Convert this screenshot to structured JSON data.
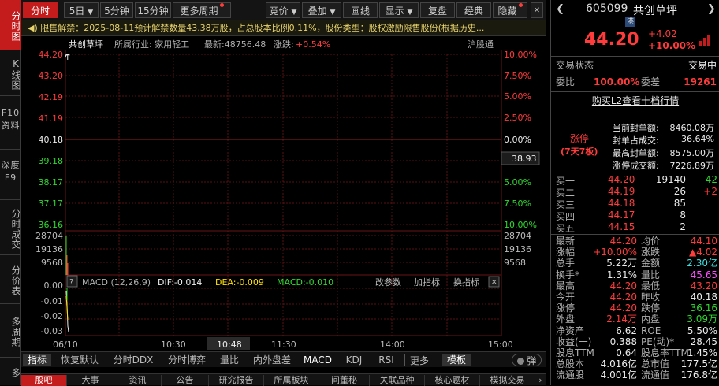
{
  "left_tabs": [
    "分时图",
    "K线图",
    "F10资料",
    "深度F9",
    "分时成交",
    "分价表",
    "多周期",
    "多"
  ],
  "toolbar": {
    "period_tabs": [
      "分时",
      "5日",
      "5分钟",
      "15分钟",
      "更多周期"
    ],
    "tools": [
      "竞价",
      "叠加",
      "画线",
      "显示",
      "复盘",
      "经典",
      "隐藏"
    ]
  },
  "notice": "限售解禁：2025-08-11预计解禁数量43.38万股，占总股本比例0.11%，股份类型：股权激励限售股份(根据历史...",
  "chart_header": {
    "name": "共创草坪",
    "industry": "所属行业: 家用轻工",
    "latest": "最新:48756.48",
    "change_label": "涨跌:",
    "change_value": "+0.54%",
    "exchange": "沪股通"
  },
  "chart_data": {
    "type": "line",
    "x": [
      "06/10",
      "10:30",
      "10:48",
      "11:30",
      "14:00",
      "15:00"
    ],
    "y_left": [
      "44.20",
      "43.20",
      "42.19",
      "41.19",
      "40.18",
      "39.18",
      "38.17",
      "37.17",
      "36.16"
    ],
    "y_right": [
      "10.00%",
      "7.50%",
      "5.00%",
      "2.50%",
      "0.00%",
      "5.00%",
      "7.50%",
      "10.00%"
    ],
    "cursor_price": "38.93",
    "volume_ticks": [
      "28704",
      "19136",
      "9568"
    ],
    "macd_ticks": [
      "0.00",
      "-0.01",
      "-0.02",
      "-0.03"
    ],
    "macd_label": "MACD (12,26,9)",
    "dif": "DIF:-0.014",
    "dea": "DEA:-0.009",
    "macd": "MACD:-0.010",
    "macd_actions": [
      "改参数",
      "加指标",
      "换指标"
    ]
  },
  "bottom_tabs": [
    "指标",
    "恢复默认",
    "分时DDX",
    "分时博弈",
    "量比",
    "内外盘差",
    "MACD",
    "KDJ",
    "RSI",
    "更多",
    "模板",
    "弹"
  ],
  "footer_tabs": [
    "股吧",
    "大事",
    "资讯",
    "公告",
    "研究报告",
    "所属板块",
    "问董秘",
    "关联品种",
    "核心题材",
    "模拟交易"
  ],
  "right": {
    "code": "605099",
    "name": "共创草坪",
    "market": "港",
    "price": "44.20",
    "change": "+4.02",
    "change_pct": "+10.00%",
    "trade_status_label": "交易状态",
    "trade_status": "交易中",
    "wb_label": "委比",
    "wb": "100.00%",
    "wc_label": "委差",
    "wc": "19261",
    "l2_link": "购买L2查看十档行情",
    "limit_label": "涨停",
    "limit_days": "(7天7板)",
    "limit_items": [
      [
        "当前封单额:",
        "8460.08万"
      ],
      [
        "封单占成交:",
        "36.64%"
      ],
      [
        "最高封单额:",
        "8575.00万"
      ],
      [
        "涨停成交额:",
        "7226.89万"
      ]
    ],
    "bids": [
      [
        "买一",
        "44.20",
        "19140",
        "-42"
      ],
      [
        "买二",
        "44.19",
        "26",
        "+2"
      ],
      [
        "买三",
        "44.18",
        "85",
        ""
      ],
      [
        "买四",
        "44.17",
        "8",
        ""
      ],
      [
        "买五",
        "44.15",
        "2",
        ""
      ]
    ],
    "stats": [
      [
        "最新",
        "44.20",
        "均价",
        "44.10"
      ],
      [
        "涨幅",
        "+10.00%",
        "涨跌",
        "▲4.02"
      ],
      [
        "总手",
        "5.22万",
        "金额",
        "2.30亿"
      ],
      [
        "换手*",
        "1.31%",
        "量比",
        "45.65"
      ],
      [
        "最高",
        "44.20",
        "最低",
        "43.20"
      ],
      [
        "今开",
        "44.20",
        "昨收",
        "40.18"
      ],
      [
        "涨停",
        "44.20",
        "跌停",
        "36.16"
      ],
      [
        "外盘",
        "2.14万",
        "内盘",
        "3.09万"
      ],
      [
        "净资产",
        "6.62",
        "ROE",
        "5.50%"
      ],
      [
        "收益(一)",
        "0.388",
        "PE(动)*",
        "28.45"
      ],
      [
        "股息TTM",
        "0.64",
        "股息率TTM",
        "1.45%"
      ],
      [
        "总股本",
        "4.016亿",
        "总市值",
        "177.5亿"
      ],
      [
        "流通股",
        "4.001亿",
        "流通值",
        "176.8亿"
      ]
    ]
  },
  "colors": {
    "up": "#ff3b3b",
    "down": "#2fd82f",
    "accent": "#c41c1c",
    "avg": "#ffe000"
  }
}
